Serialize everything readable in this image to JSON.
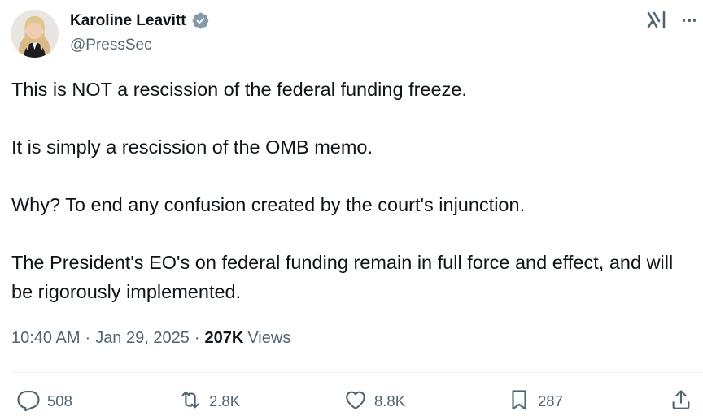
{
  "author": {
    "name": "Karoline Leavitt",
    "handle": "@PressSec",
    "verified": true,
    "verified_color": "#829aab"
  },
  "tweet": {
    "paragraphs": [
      "This is NOT a rescission of the federal funding freeze.",
      "It is simply a rescission of the OMB memo.",
      "Why? To end any confusion created by the court's injunction.",
      "The President's EO's on federal funding remain in full force and effect, and will be rigorously implemented."
    ],
    "time": "10:40 AM",
    "date": "Jan 29, 2025",
    "separator": "·",
    "views_count": "207K",
    "views_label": "Views"
  },
  "actions": {
    "replies": "508",
    "reposts": "2.8K",
    "likes": "8.8K",
    "bookmarks": "287"
  },
  "icons": {
    "verified": "verified-badge-icon",
    "grok": "grok-icon",
    "more": "more-icon",
    "reply": "reply-icon",
    "repost": "repost-icon",
    "like": "heart-icon",
    "bookmark": "bookmark-icon",
    "share": "share-icon"
  },
  "colors": {
    "text": "#0f1419",
    "muted": "#536471",
    "divider": "#eff3f4"
  }
}
